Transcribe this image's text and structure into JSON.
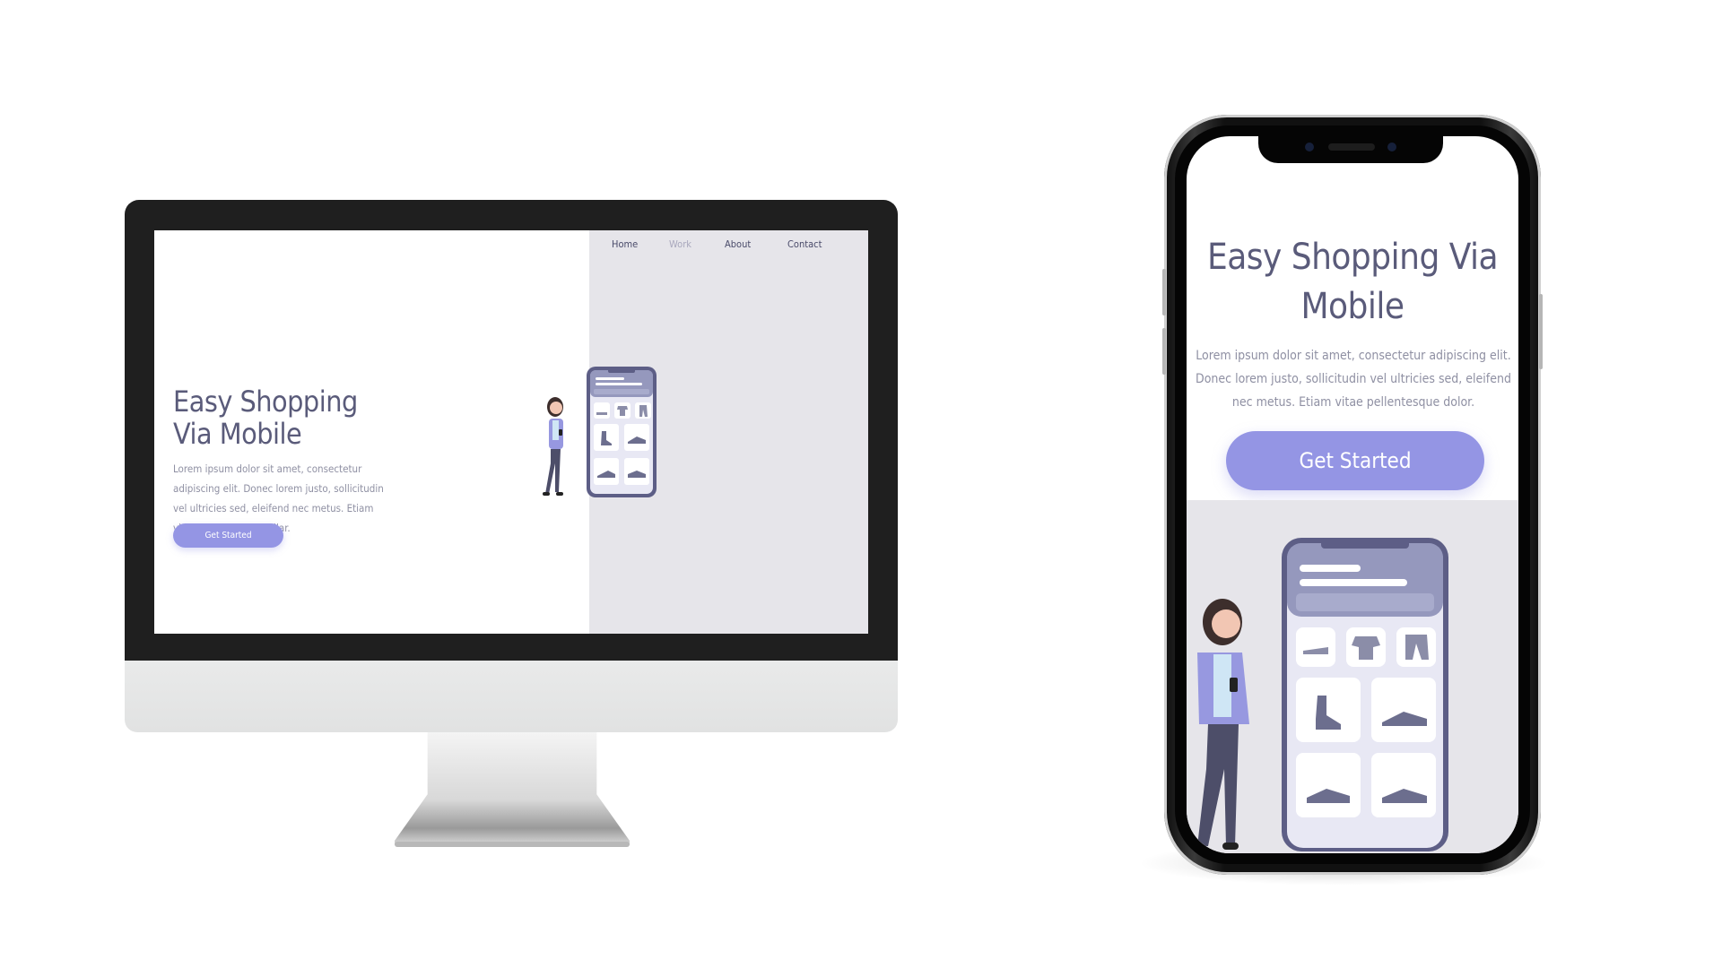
{
  "desktop": {
    "nav": [
      "Home",
      "Work",
      "About",
      "Contact"
    ],
    "hero_title_line1": "Easy Shopping",
    "hero_title_line2": "Via Mobile",
    "hero_text": "Lorem ipsum dolor sit amet, consectetur adipiscing elit. Donec lorem justo, sollicitudin vel ultricies sed, eleifend nec metus. Etiam vitae pellentesque dollar.",
    "cta_label": "Get Started"
  },
  "mobile": {
    "hero_title": "Easy Shopping Via Mobile",
    "hero_text": "Lorem ipsum dolor sit amet, consectetur adipiscing elit. Donec lorem justo, sollicitudin vel ultricies sed, eleifend nec metus. Etiam vitae pellentesque dolor.",
    "cta_label": "Get Started"
  },
  "colors": {
    "accent": "#9495e4",
    "heading": "#5a5b7a",
    "body_text": "#8f90a3",
    "panel_bg": "#e6e5ea",
    "nav_dim": "#a9a8bd",
    "bezel": "#1f1f1f"
  },
  "icons": [
    "woman-with-phone-illustration",
    "phone-illustration",
    "shoe-icon",
    "tshirt-icon",
    "pants-icon",
    "boot-icon",
    "sneaker-icon"
  ]
}
